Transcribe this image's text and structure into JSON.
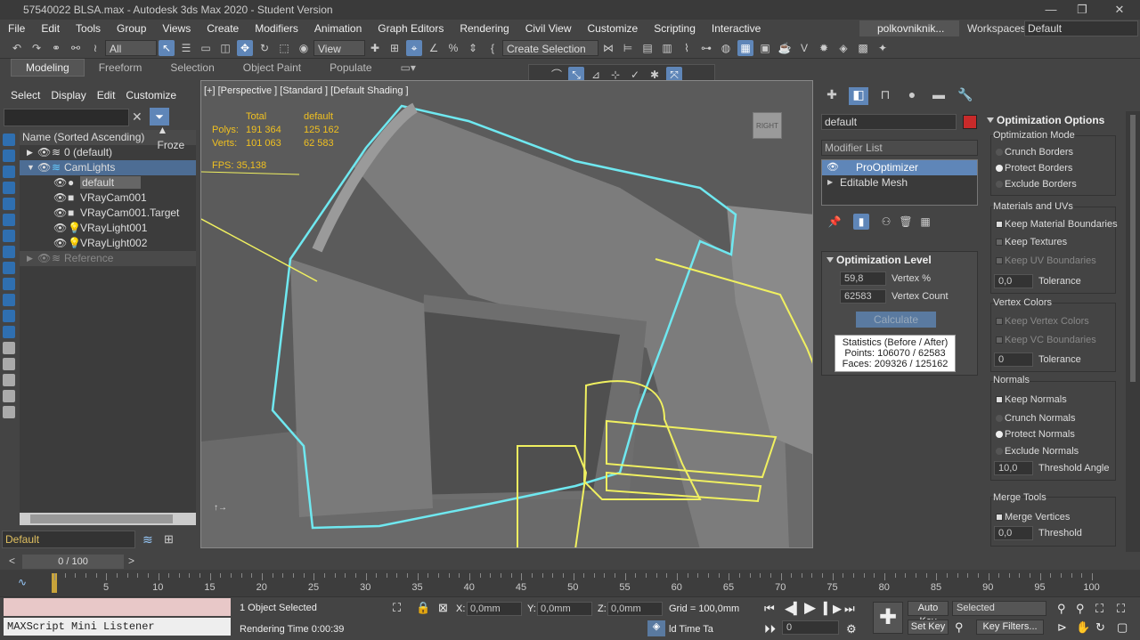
{
  "window": {
    "title": "57540022 BLSA.max - Autodesk 3ds Max 2020 - Student Version",
    "logo": "3"
  },
  "menu": [
    "File",
    "Edit",
    "Tools",
    "Group",
    "Views",
    "Create",
    "Modifiers",
    "Animation",
    "Graph Editors",
    "Rendering",
    "Civil View",
    "Customize",
    "Scripting",
    "Interactive"
  ],
  "user": "polkovniknik...",
  "workspaces": {
    "label": "Workspaces:",
    "value": "Default"
  },
  "toolbar": {
    "filter": "All",
    "view": "View",
    "selset": "Create Selection Se"
  },
  "ribbon": [
    "Modeling",
    "Freeform",
    "Selection",
    "Object Paint",
    "Populate"
  ],
  "axes": [
    "X",
    "Y",
    "Z",
    "XY",
    "XY"
  ],
  "scene_explorer": {
    "tabs": [
      "Select",
      "Display",
      "Edit",
      "Customize"
    ],
    "col_name": "Name (Sorted Ascending)",
    "col_freeze": "▲ Froze",
    "rows": [
      "0 (default)",
      "CamLights",
      "default",
      "VRayCam001",
      "VRayCam001.Target",
      "VRayLight001",
      "VRayLight002",
      "Reference"
    ]
  },
  "layer": "Default",
  "viewport": {
    "label": "[+] [Perspective ] [Standard ] [Default Shading ]",
    "stats_total": "Total",
    "stats_default": "default",
    "polys_label": "Polys:",
    "polys_total": "191 364",
    "polys_default": "125 162",
    "verts_label": "Verts:",
    "verts_total": "101 063",
    "verts_default": "62 583",
    "fps": "FPS:   35,138",
    "viewcube": "RIGHT"
  },
  "command_panel": {
    "name": "default",
    "modifier_list": "Modifier List",
    "stack": [
      "ProOptimizer",
      "Editable Mesh"
    ],
    "opt_level": "Optimization Level",
    "vertex_pct": "59,8",
    "vertex_pct_label": "Vertex %",
    "vertex_count": "62583",
    "vertex_count_label": "Vertex Count",
    "calculate": "Calculate",
    "stats_title": "Statistics (Before / After)",
    "stats_points": "Points: 106070 / 62583",
    "stats_faces": "Faces: 209326 / 125162"
  },
  "options": {
    "title": "Optimization Options",
    "mode_label": "Optimization Mode",
    "crunch": "Crunch Borders",
    "protect": "Protect Borders",
    "exclude": "Exclude Borders",
    "mat_label": "Materials and UVs",
    "keep_mat": "Keep Material Boundaries",
    "keep_tex": "Keep Textures",
    "keep_uv": "Keep UV Boundaries",
    "tol1": "0,0",
    "tolerance": "Tolerance",
    "vc_label": "Vertex Colors",
    "keep_vc": "Keep Vertex Colors",
    "keep_vcb": "Keep VC Boundaries",
    "tol2": "0",
    "normals_label": "Normals",
    "keep_normals": "Keep Normals",
    "crunch_n": "Crunch Normals",
    "protect_n": "Protect Normals",
    "exclude_n": "Exclude Normals",
    "thr_angle_v": "10,0",
    "thr_angle": "Threshold Angle",
    "merge_label": "Merge Tools",
    "merge_v": "Merge Vertices",
    "thr_v": "0,0",
    "threshold": "Threshold"
  },
  "timeline": {
    "slider": "0 / 100",
    "ticks": [
      "0",
      "5",
      "10",
      "15",
      "20",
      "25",
      "30",
      "35",
      "40",
      "45",
      "50",
      "55",
      "60",
      "65",
      "70",
      "75",
      "80",
      "85",
      "90",
      "95",
      "100"
    ]
  },
  "status": {
    "listener": "MAXScript Mini Listener",
    "selected": "1 Object Selected",
    "render_time": "Rendering Time  0:00:39",
    "x": "0,0mm",
    "y": "0,0mm",
    "z": "0,0mm",
    "grid": "Grid = 100,0mm",
    "addtime": "ld Time Ta",
    "autokey": "Auto Key",
    "setkey": "Set Key",
    "sel_dd": "Selected",
    "keyfilters": "Key Filters...",
    "frame": "0"
  }
}
